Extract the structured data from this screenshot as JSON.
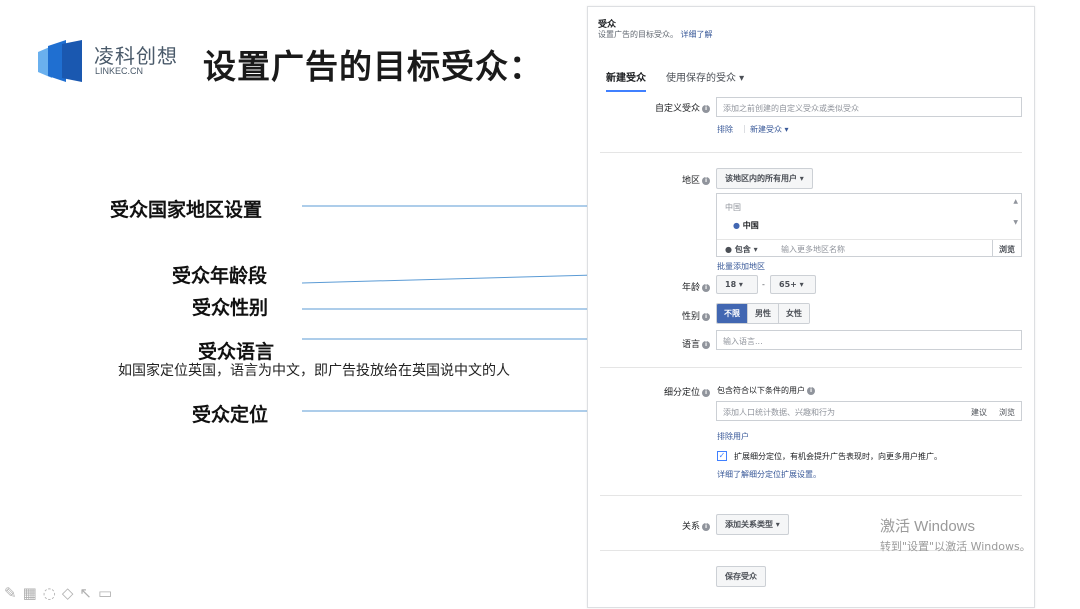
{
  "slide": {
    "logo_cn": "凌科创想",
    "logo_en": "LINKEC.CN",
    "title": "设置广告的目标受众：",
    "annotations": {
      "region": "受众国家地区设置",
      "age": "受众年龄段",
      "gender": "受众性别",
      "language": "受众语言",
      "language_note": "如国家定位英国，语言为中文，即广告投放给在英国说中文的人",
      "targeting": "受众定位"
    },
    "toolbar_icons": [
      "pen-icon",
      "grid-icon",
      "lasso-icon",
      "eraser-icon",
      "pointer-icon",
      "camera-icon"
    ]
  },
  "panel": {
    "title": "受众",
    "subtitle": "设置广告的目标受众。",
    "learn_more": "详细了解",
    "tabs": [
      {
        "label": "新建受众",
        "active": true
      },
      {
        "label": "使用保存的受众 ▾",
        "active": false
      }
    ],
    "custom_audience": {
      "label": "自定义受众",
      "placeholder": "添加之前创建的自定义受众或类似受众",
      "exclude": "排除",
      "create": "新建受众 ▾"
    },
    "location": {
      "label": "地区",
      "dropdown": "该地区内的所有用户 ▾",
      "box_label": "中国",
      "selected": "中国",
      "include": "包含 ▾",
      "placeholder": "输入更多地区名称",
      "browse": "浏览",
      "bulk": "批量添加地区"
    },
    "age": {
      "label": "年龄",
      "min": "18 ▾",
      "dash": "-",
      "max": "65+ ▾"
    },
    "gender": {
      "label": "性别",
      "options": [
        "不限",
        "男性",
        "女性"
      ],
      "selected": "不限"
    },
    "language": {
      "label": "语言",
      "placeholder": "输入语言..."
    },
    "detailed": {
      "label": "细分定位",
      "include_text": "包含符合以下条件的用户",
      "placeholder": "添加人口统计数据、兴趣和行为",
      "suggest": "建议",
      "browse": "浏览",
      "exclude": "排除用户",
      "expand_text": "扩展细分定位，有机会提升广告表现时，向更多用户推广。",
      "expand_link": "详细了解细分定位扩展设置。",
      "expand_checked": true
    },
    "connections": {
      "label": "关系",
      "dropdown": "添加关系类型 ▾"
    },
    "save_button": "保存受众"
  },
  "watermark": {
    "line1": "激活 Windows",
    "line2": "转到\"设置\"以激活 Windows。"
  },
  "colors": {
    "accent": "#4080ff",
    "selected": "#4267b2",
    "link": "#385898",
    "logo_blue": "#1f6fd1",
    "logo_light": "#6ab0ee",
    "arrow": "#5b9bd5"
  }
}
